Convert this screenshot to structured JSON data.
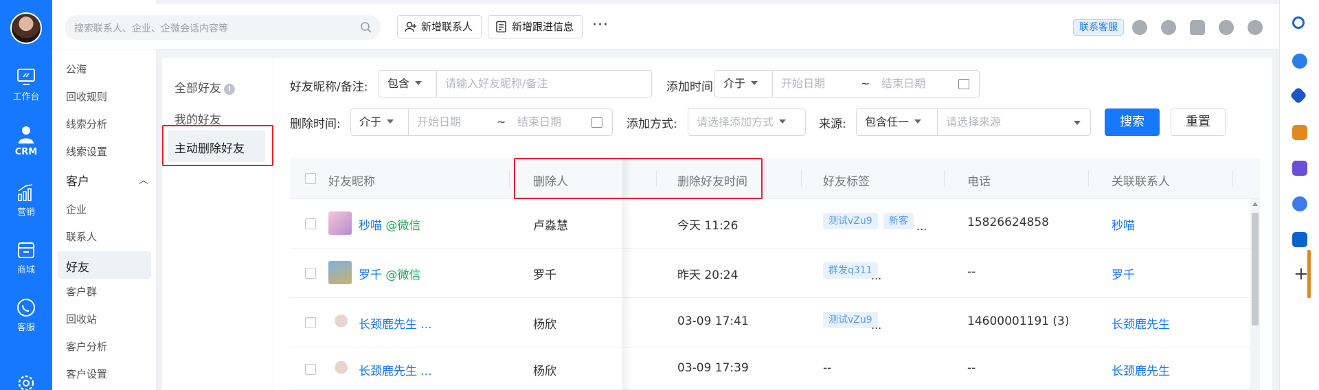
{
  "rail": {
    "items": [
      {
        "label": "工作台",
        "icon": "monitor-icon"
      },
      {
        "label": "CRM",
        "icon": "user-icon",
        "active": true
      },
      {
        "label": "营销",
        "icon": "bar-chart-icon"
      },
      {
        "label": "商城",
        "icon": "store-icon"
      },
      {
        "label": "客服",
        "icon": "phone-chat-icon"
      }
    ]
  },
  "subnav": {
    "items": [
      "公海",
      "回收规则",
      "线索分析",
      "线索设置"
    ],
    "group_label": "客户",
    "group_items": [
      "企业",
      "联系人",
      "好友",
      "客户群",
      "回收站",
      "客户分析",
      "客户设置"
    ],
    "selected": "好友"
  },
  "topbar": {
    "search_placeholder": "搜索联系人、企业、企微会话内容等",
    "new_contact_label": "新增联系人",
    "new_followup_label": "新增跟进信息",
    "more_label": "···",
    "service_label": "联系客服"
  },
  "tabs": {
    "all_friends": "全部好友",
    "info_icon": "i",
    "my_friends": "我的好友",
    "active_deleted": "主动删除好友"
  },
  "filters": {
    "nickname_label": "好友昵称/备注:",
    "nickname_op": "包含",
    "nickname_placeholder": "请输入好友昵称/备注",
    "add_time_label": "添加时间:",
    "add_time_op": "介于",
    "start_placeholder": "开始日期",
    "tilde": "~",
    "end_placeholder": "结束日期",
    "delete_time_label": "删除时间:",
    "delete_time_op": "介于",
    "add_method_label": "添加方式:",
    "add_method_placeholder": "请选择添加方式",
    "source_label": "来源:",
    "source_op": "包含任一",
    "source_placeholder": "请选择来源",
    "search_btn": "搜索",
    "reset_btn": "重置"
  },
  "table": {
    "headers": {
      "nickname": "好友昵称",
      "deleter": "删除人",
      "delete_time": "删除好友时间",
      "tags": "好友标签",
      "phone": "电话",
      "contact": "关联联系人"
    },
    "rows": [
      {
        "name": "秒喵",
        "suffix": " @微信",
        "deleter": "卢淼慧",
        "time": "今天 11:26",
        "tags": [
          "测试vZu9",
          "新客"
        ],
        "more": "...",
        "phone": "15826624858",
        "contact": "秒喵"
      },
      {
        "name": "罗千",
        "suffix": " @微信",
        "deleter": "罗千",
        "time": "昨天 20:24",
        "tags": [
          "群发q311"
        ],
        "more": "...",
        "phone": "--",
        "contact": "罗千"
      },
      {
        "name": "长颈鹿先生 ...",
        "suffix": "",
        "deleter": "杨欣",
        "time": "03-09 17:41",
        "tags": [
          "测试vZu9"
        ],
        "more": "...",
        "phone": "14600001191 (3)",
        "contact": "长颈鹿先生"
      },
      {
        "name": "长颈鹿先生 ...",
        "suffix": "",
        "deleter": "杨欣",
        "time": "03-09 17:39",
        "tags": [],
        "more": "--",
        "phone": "--",
        "contact": "长颈鹿先生"
      }
    ]
  },
  "colors": {
    "primary": "#1677ff",
    "highlight": "#e8202a",
    "wechat": "#1aad5a"
  }
}
